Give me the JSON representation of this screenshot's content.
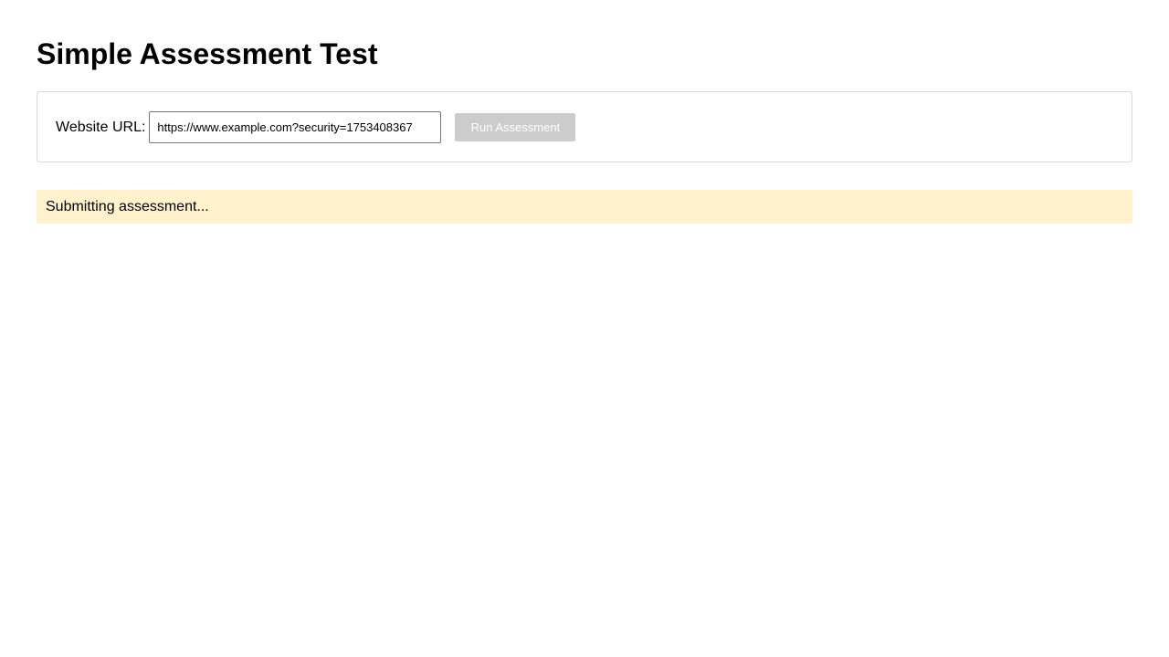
{
  "page": {
    "title": "Simple Assessment Test"
  },
  "form": {
    "url_label": "Website URL:",
    "url_value": "https://www.example.com?security=1753408367",
    "run_button_label": "Run Assessment",
    "run_button_disabled": true
  },
  "status": {
    "message": "Submitting assessment...",
    "background_color": "#fff2cc"
  },
  "colors": {
    "button_disabled_bg": "#cccccc",
    "panel_border": "#d8d8d8"
  }
}
